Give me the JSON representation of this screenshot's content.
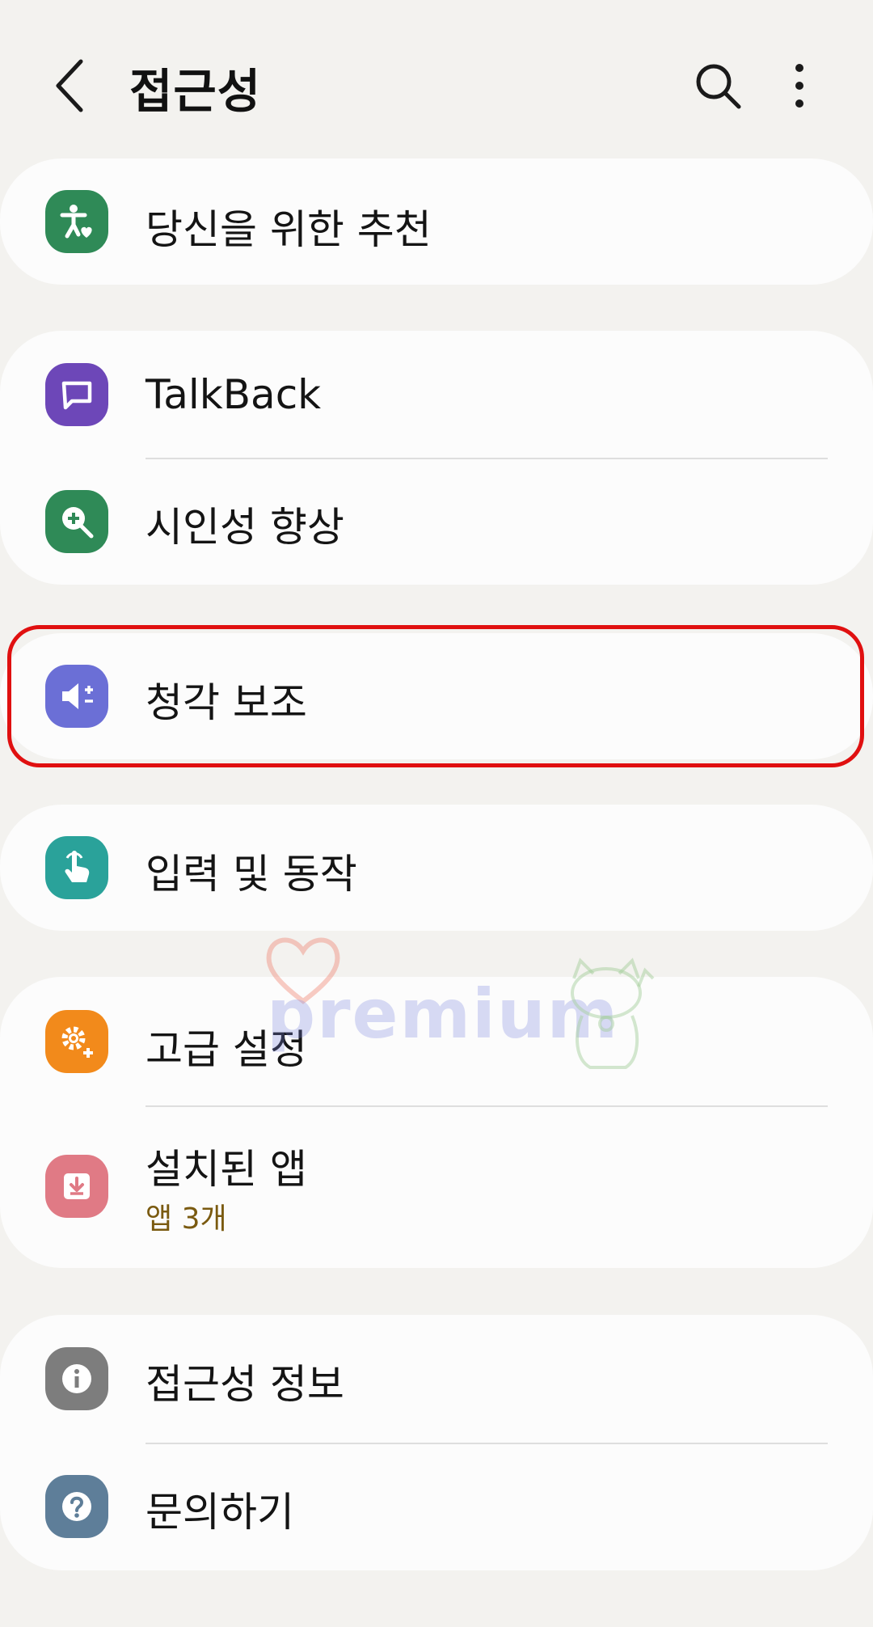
{
  "header": {
    "title": "접근성",
    "back_icon": "chevron-left-icon",
    "search_icon": "search-icon",
    "more_icon": "more-vert-icon"
  },
  "sections": [
    {
      "items": [
        {
          "label": "당신을 위한 추천",
          "icon": "accessibility-heart-icon",
          "icon_color": "#2f8a57"
        }
      ]
    },
    {
      "items": [
        {
          "label": "TalkBack",
          "icon": "talkback-bubble-icon",
          "icon_color": "#6d47b8"
        },
        {
          "label": "시인성 향상",
          "icon": "magnifier-plus-icon",
          "icon_color": "#2f8a57"
        }
      ]
    },
    {
      "items": [
        {
          "label": "청각 보조",
          "icon": "speaker-plus-minus-icon",
          "icon_color": "#6b6fd6"
        }
      ]
    },
    {
      "items": [
        {
          "label": "입력 및 동작",
          "icon": "touch-hand-icon",
          "icon_color": "#2aa29a"
        }
      ]
    },
    {
      "items": [
        {
          "label": "고급 설정",
          "icon": "gear-plus-icon",
          "icon_color": "#f28a1b"
        },
        {
          "label": "설치된 앱",
          "sublabel": "앱 3개",
          "icon": "download-tray-icon",
          "icon_color": "#e07a85"
        }
      ]
    },
    {
      "items": [
        {
          "label": "접근성 정보",
          "icon": "info-icon",
          "icon_color": "#7d7d7d"
        },
        {
          "label": "문의하기",
          "icon": "question-icon",
          "icon_color": "#5e7e99"
        }
      ]
    }
  ],
  "watermark": {
    "text": "premium"
  },
  "colors": {
    "highlight": "#e01010",
    "background": "#f3f2ef",
    "card": "#fcfcfc"
  }
}
